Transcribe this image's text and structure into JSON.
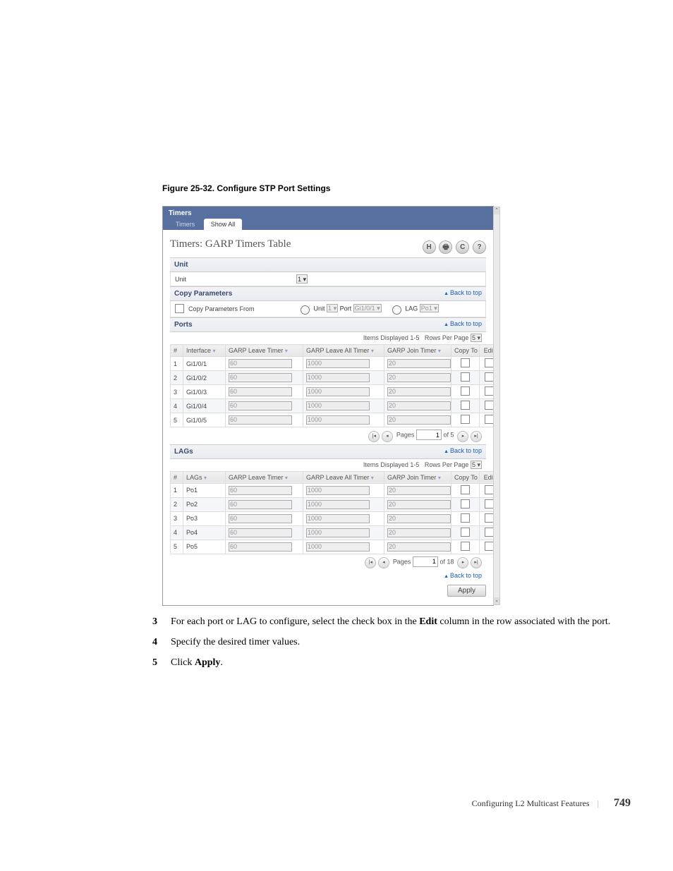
{
  "figure_caption": "Figure 25-32.    Configure STP Port Settings",
  "app": {
    "title": "Timers",
    "tabs": {
      "timers": "Timers",
      "show_all": "Show All"
    },
    "page_title": "Timers: GARP Timers Table",
    "toolbar_icons": {
      "save": "H",
      "print": "🖶",
      "refresh": "C",
      "help": "?"
    }
  },
  "sections": {
    "unit": {
      "bar": "Unit",
      "label": "Unit",
      "value": "1"
    },
    "copy_params": {
      "bar": "Copy Parameters",
      "back_to_top": "Back to top",
      "from_label": "Copy Parameters From",
      "unit_label": "Unit",
      "unit_value": "1",
      "port_label": "Port",
      "port_value": "Gi1/0/1",
      "lag_label": "LAG",
      "lag_value": "Po1"
    },
    "ports": {
      "bar": "Ports",
      "back_to_top": "Back to top",
      "items_displayed": "Items Displayed 1-5",
      "rows_per_page_label": "Rows Per Page",
      "rows_per_page_value": "5",
      "headers": {
        "num": "#",
        "interface": "Interface",
        "leave": "GARP Leave Timer",
        "leave_all": "GARP Leave All Timer",
        "join": "GARP Join Timer",
        "copy_to": "Copy To",
        "edit": "Edit"
      },
      "rows": [
        {
          "n": "1",
          "iface": "Gi1/0/1",
          "leave": "60",
          "leave_all": "1000",
          "join": "20"
        },
        {
          "n": "2",
          "iface": "Gi1/0/2",
          "leave": "60",
          "leave_all": "1000",
          "join": "20"
        },
        {
          "n": "3",
          "iface": "Gi1/0/3",
          "leave": "60",
          "leave_all": "1000",
          "join": "20"
        },
        {
          "n": "4",
          "iface": "Gi1/0/4",
          "leave": "60",
          "leave_all": "1000",
          "join": "20"
        },
        {
          "n": "5",
          "iface": "Gi1/0/5",
          "leave": "60",
          "leave_all": "1000",
          "join": "20"
        }
      ],
      "pager": {
        "pages_label": "Pages",
        "page": "1",
        "of_text": "of 5"
      }
    },
    "lags": {
      "bar": "LAGs",
      "back_to_top": "Back to top",
      "items_displayed": "Items Displayed 1-5",
      "rows_per_page_label": "Rows Per Page",
      "rows_per_page_value": "5",
      "headers": {
        "num": "#",
        "lags": "LAGs",
        "leave": "GARP Leave Timer",
        "leave_all": "GARP Leave All Timer",
        "join": "GARP Join Timer",
        "copy_to": "Copy To",
        "edit": "Edit"
      },
      "rows": [
        {
          "n": "1",
          "iface": "Po1",
          "leave": "60",
          "leave_all": "1000",
          "join": "20"
        },
        {
          "n": "2",
          "iface": "Po2",
          "leave": "60",
          "leave_all": "1000",
          "join": "20"
        },
        {
          "n": "3",
          "iface": "Po3",
          "leave": "60",
          "leave_all": "1000",
          "join": "20"
        },
        {
          "n": "4",
          "iface": "Po4",
          "leave": "60",
          "leave_all": "1000",
          "join": "20"
        },
        {
          "n": "5",
          "iface": "Po5",
          "leave": "60",
          "leave_all": "1000",
          "join": "20"
        }
      ],
      "pager": {
        "pages_label": "Pages",
        "page": "1",
        "of_text": "of 18"
      },
      "back_to_top_bottom": "Back to top"
    },
    "apply": "Apply"
  },
  "steps": {
    "s3n": "3",
    "s3t_a": "For each port or LAG to configure, select the check box in the ",
    "s3t_b": "Edit",
    "s3t_c": " column in the row associated with the port.",
    "s4n": "4",
    "s4t": "Specify the desired timer values.",
    "s5n": "5",
    "s5t_a": "Click ",
    "s5t_b": "Apply",
    "s5t_c": "."
  },
  "footer": {
    "chapter": "Configuring L2 Multicast Features",
    "page": "749"
  }
}
